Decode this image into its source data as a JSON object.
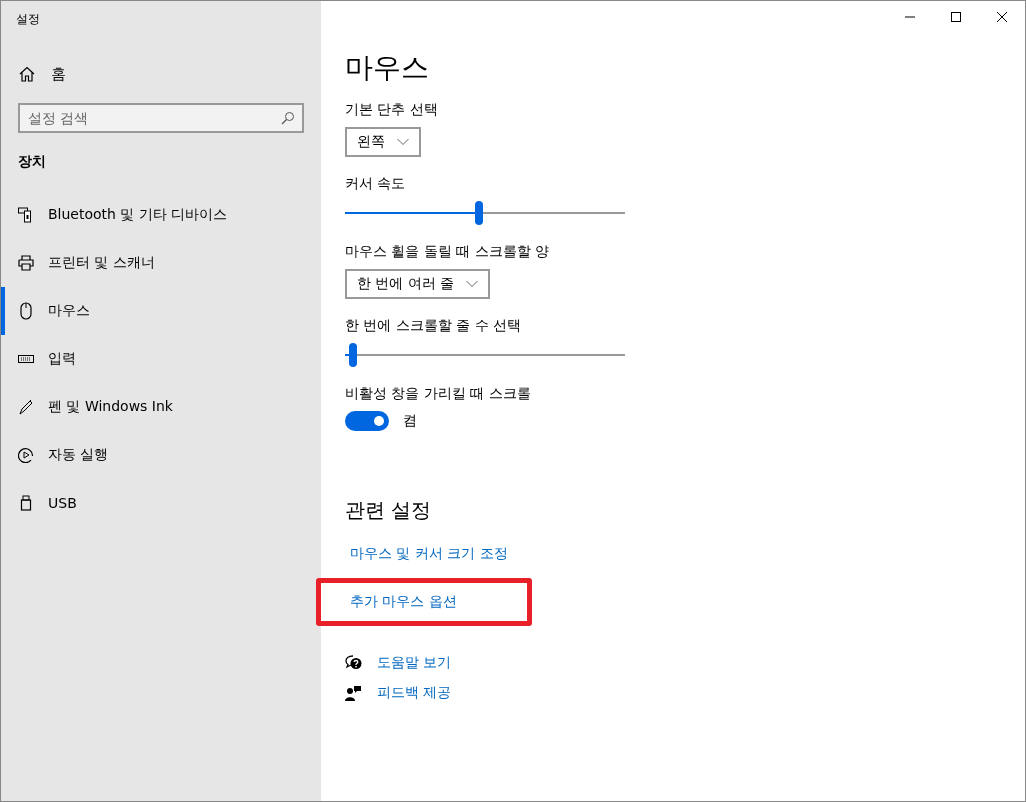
{
  "window": {
    "title": "설정"
  },
  "sidebar": {
    "home": "홈",
    "search": {
      "placeholder": "설정 검색"
    },
    "section": "장치",
    "items": [
      {
        "label": "Bluetooth 및 기타 디바이스",
        "selected": false
      },
      {
        "label": "프린터 및 스캐너",
        "selected": false
      },
      {
        "label": "마우스",
        "selected": true
      },
      {
        "label": "입력",
        "selected": false
      },
      {
        "label": "펜 및 Windows Ink",
        "selected": false
      },
      {
        "label": "자동 실행",
        "selected": false
      },
      {
        "label": "USB",
        "selected": false
      }
    ]
  },
  "page": {
    "title": "마우스",
    "settings": [
      {
        "kind": "dropdown",
        "label": "기본 단추 선택",
        "value": "왼쪽"
      },
      {
        "kind": "slider",
        "label": "커서 속도",
        "level": 0.48
      },
      {
        "kind": "dropdown",
        "label": "마우스 휠을 돌릴 때 스크롤할 양",
        "value": "한 번에 여러 줄"
      },
      {
        "kind": "slider",
        "label": "한 번에 스크롤할 줄 수 선택",
        "level": 0.03
      },
      {
        "kind": "toggle",
        "label": "비활성 창을 가리킬 때 스크롤",
        "on": true,
        "state": "켬"
      }
    ],
    "related": {
      "title": "관련 설정",
      "links": [
        {
          "label": "마우스 및 커서 크기 조정",
          "highlighted": false
        },
        {
          "label": "추가 마우스 옵션",
          "highlighted": true
        }
      ]
    },
    "help": [
      {
        "label": "도움말 보기"
      },
      {
        "label": "피드백 제공"
      }
    ]
  }
}
